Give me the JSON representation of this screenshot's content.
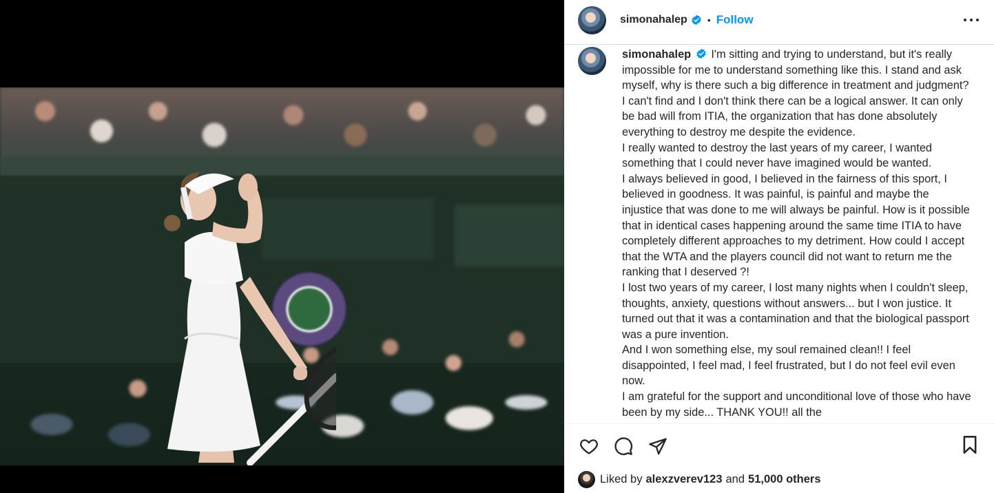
{
  "header": {
    "username": "simonahalep",
    "separator": "•",
    "follow_label": "Follow",
    "verified_icon": "verified-badge-icon",
    "more_icon": "more-options-icon"
  },
  "caption": {
    "username": "simonahalep",
    "paragraphs": [
      "I'm sitting and trying to understand, but it's really impossible for me to understand something like this. I stand and ask myself, why is there such a big difference in treatment and judgment? I can't find and I don't think there can be a logical answer. It can only be bad will from ITIA, the organization that has done absolutely everything to destroy me despite the evidence.",
      "I really wanted to destroy the last years of my career, I wanted something that I could never have imagined would be wanted.",
      "I always believed in good, I believed in the fairness of this sport, I believed in goodness. It was painful, is painful and maybe the injustice that was done to me will always be painful. How is it possible that in identical cases happening around the same time ITIA to have completely different approaches to my detriment. How could I accept that the WTA and the players council did not want to return me the ranking that I deserved ?!",
      "I lost two years of my career, I lost many nights when I couldn't sleep, thoughts, anxiety, questions without answers... but I won justice. It turned out that it was a contamination and that the biological passport was a pure invention.",
      "And I won something else, my soul remained clean!! I feel disappointed, I feel mad, I feel frustrated, but I do not feel evil even now.",
      "I am grateful for the support and unconditional love of those who have been by my side... THANK YOU!! all the"
    ]
  },
  "actions": {
    "like_icon": "heart-icon",
    "comment_icon": "comment-icon",
    "share_icon": "share-icon",
    "save_icon": "bookmark-icon"
  },
  "likes": {
    "prefix": "Liked by",
    "user": "alexzverev123",
    "conj": "and",
    "others": "51,000 others"
  },
  "colors": {
    "accent": "#0095f6",
    "text": "#262626",
    "divider": "#dbdbdb"
  }
}
